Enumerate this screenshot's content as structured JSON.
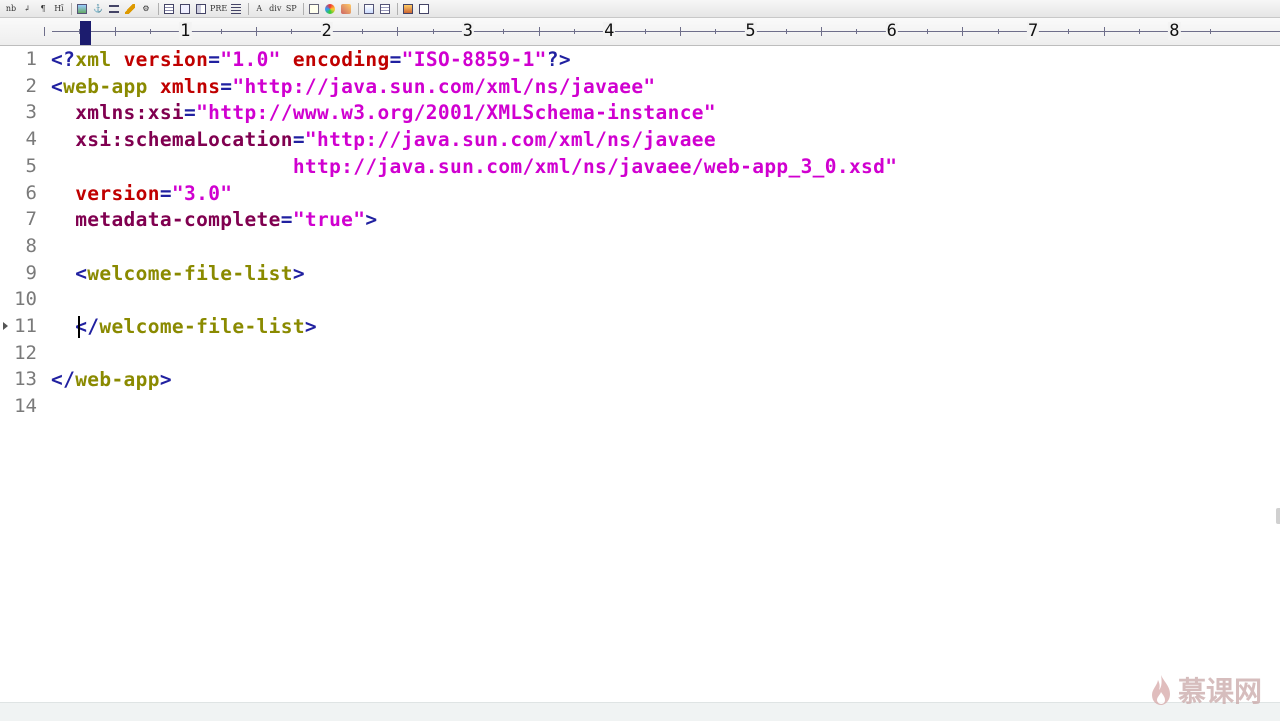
{
  "toolbar": {
    "buttons": [
      {
        "name": "nbsp-button",
        "label": "nb"
      },
      {
        "name": "line-break-button",
        "label": "↲"
      },
      {
        "name": "paragraph-button",
        "label": "¶"
      },
      {
        "name": "heading-button",
        "label": "Hī"
      },
      {
        "sep": true
      },
      {
        "name": "image-button",
        "icon": "image-icon"
      },
      {
        "name": "anchor-button",
        "label": "⚓"
      },
      {
        "name": "hr-button",
        "icon": "hr-icon"
      },
      {
        "name": "edit-button",
        "icon": "pencil-icon"
      },
      {
        "name": "settings-button",
        "label": "⚙"
      },
      {
        "sep": true
      },
      {
        "name": "table-button",
        "icon": "table-icon"
      },
      {
        "name": "form-button",
        "icon": "form-icon"
      },
      {
        "name": "frame-button",
        "icon": "frame-icon"
      },
      {
        "name": "pre-button",
        "label": "PRE"
      },
      {
        "name": "list-button",
        "icon": "list-icon"
      },
      {
        "sep": true
      },
      {
        "name": "font-button",
        "label": "A"
      },
      {
        "name": "div-button",
        "label": "div"
      },
      {
        "name": "span-button",
        "label": "SP"
      },
      {
        "sep": true
      },
      {
        "name": "page-button",
        "icon": "page-icon"
      },
      {
        "name": "color-button",
        "icon": "palette-icon"
      },
      {
        "name": "script-button",
        "icon": "script-icon"
      },
      {
        "sep": true
      },
      {
        "name": "validate-button",
        "icon": "validate-icon"
      },
      {
        "name": "style-button",
        "icon": "style-icon"
      },
      {
        "sep": true
      },
      {
        "name": "preview-button",
        "icon": "preview-icon"
      },
      {
        "name": "window-button",
        "icon": "window-icon"
      }
    ]
  },
  "ruler": {
    "numbers": [
      "1",
      "2",
      "3",
      "4",
      "5",
      "6",
      "7",
      "8"
    ]
  },
  "editor": {
    "current_line": 11,
    "lines": [
      {
        "n": "1",
        "tokens": [
          [
            "lt",
            "<?"
          ],
          [
            "tg",
            "xml"
          ],
          [
            "t",
            " "
          ],
          [
            "at",
            "version"
          ],
          [
            "eq",
            "="
          ],
          [
            "vl",
            "\"1.0\""
          ],
          [
            "t",
            " "
          ],
          [
            "at",
            "encoding"
          ],
          [
            "eq",
            "="
          ],
          [
            "vl",
            "\"ISO-8859-1\""
          ],
          [
            "lt",
            "?>"
          ]
        ]
      },
      {
        "n": "2",
        "tokens": [
          [
            "lt",
            "<"
          ],
          [
            "tg",
            "web-app"
          ],
          [
            "t",
            " "
          ],
          [
            "at",
            "xmlns"
          ],
          [
            "eq",
            "="
          ],
          [
            "vl",
            "\"http://java.sun.com/xml/ns/javaee\""
          ]
        ]
      },
      {
        "n": "3",
        "tokens": [
          [
            "t",
            "  "
          ],
          [
            "ax",
            "xmlns:xsi"
          ],
          [
            "eq",
            "="
          ],
          [
            "vl",
            "\"http://www.w3.org/2001/XMLSchema-instance\""
          ]
        ]
      },
      {
        "n": "4",
        "tokens": [
          [
            "t",
            "  "
          ],
          [
            "ax",
            "xsi:schemaLocation"
          ],
          [
            "eq",
            "="
          ],
          [
            "vl",
            "\"http://java.sun.com/xml/ns/javaee"
          ]
        ]
      },
      {
        "n": "5",
        "tokens": [
          [
            "t",
            "                    "
          ],
          [
            "vl",
            "http://java.sun.com/xml/ns/javaee/web-app_3_0.xsd\""
          ]
        ]
      },
      {
        "n": "6",
        "tokens": [
          [
            "t",
            "  "
          ],
          [
            "at",
            "version"
          ],
          [
            "eq",
            "="
          ],
          [
            "vl",
            "\"3.0\""
          ]
        ]
      },
      {
        "n": "7",
        "tokens": [
          [
            "t",
            "  "
          ],
          [
            "ax",
            "metadata-complete"
          ],
          [
            "eq",
            "="
          ],
          [
            "vl",
            "\"true\""
          ],
          [
            "lt",
            ">"
          ]
        ]
      },
      {
        "n": "8",
        "tokens": []
      },
      {
        "n": "9",
        "tokens": [
          [
            "t",
            "  "
          ],
          [
            "lt",
            "<"
          ],
          [
            "tg",
            "welcome-file-list"
          ],
          [
            "lt",
            ">"
          ]
        ]
      },
      {
        "n": "10",
        "tokens": []
      },
      {
        "n": "11",
        "tokens": [
          [
            "t",
            "  "
          ],
          [
            "lt",
            "</"
          ],
          [
            "tg",
            "welcome-file-list"
          ],
          [
            "lt",
            ">"
          ]
        ]
      },
      {
        "n": "12",
        "tokens": []
      },
      {
        "n": "13",
        "tokens": [
          [
            "lt",
            "</"
          ],
          [
            "tg",
            "web-app"
          ],
          [
            "lt",
            ">"
          ]
        ]
      },
      {
        "n": "14",
        "tokens": []
      }
    ]
  },
  "watermark": {
    "text": "慕课网"
  },
  "colors": {
    "punct": "#2020a0",
    "tag": "#8a8a00",
    "attribute": "#c00000",
    "ns_attribute": "#800050",
    "value": "#d000d0",
    "line_number": "#7a7a7a"
  }
}
